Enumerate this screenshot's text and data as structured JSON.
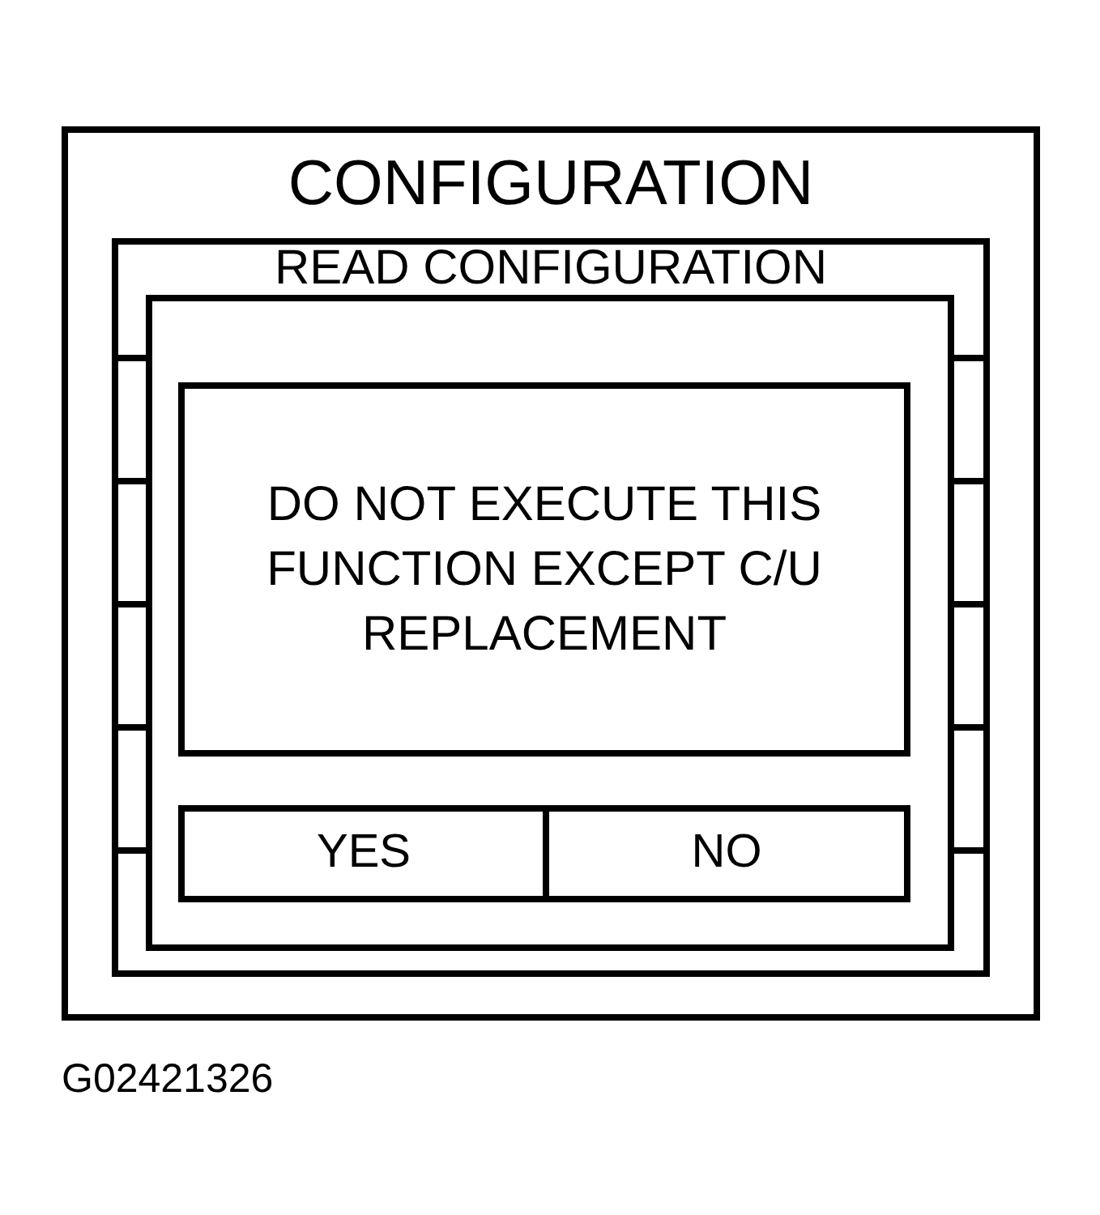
{
  "window": {
    "title": "CONFIGURATION"
  },
  "background_screen": {
    "heading": "READ CONFIGURATION"
  },
  "dialog": {
    "message": "DO NOT EXECUTE THIS FUNCTION EXCEPT C/U REPLACEMENT",
    "buttons": [
      "YES",
      "NO"
    ]
  },
  "figure_id": "G02421326"
}
